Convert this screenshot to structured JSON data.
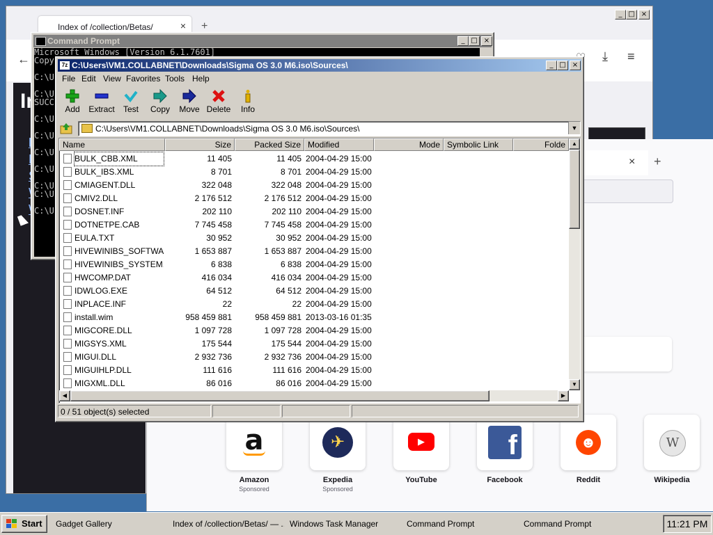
{
  "firefox_back": {
    "tab_title": "Index of /collection/Betas/",
    "tab_close": "×",
    "new_tab": "+",
    "page_heading": "In",
    "links": [
      "F",
      "P",
      "S",
      "W",
      "W"
    ]
  },
  "firefox_front": {
    "tab_close": "×",
    "new_tab": "+",
    "shortcuts": [
      {
        "label": "Amazon",
        "sponsored": "Sponsored",
        "glyph": "a"
      },
      {
        "label": "Expedia",
        "sponsored": "Sponsored",
        "glyph": "✈"
      },
      {
        "label": "YouTube",
        "sponsored": "",
        "glyph": "▶"
      },
      {
        "label": "Facebook",
        "sponsored": "",
        "glyph": "f"
      },
      {
        "label": "Reddit",
        "sponsored": "",
        "glyph": "☻"
      },
      {
        "label": "Wikipedia",
        "sponsored": "",
        "glyph": "W"
      }
    ]
  },
  "cmd": {
    "title": "Command Prompt",
    "console": "Microsoft Windows [Version 6.1.7601]\nCopy\n\nC:\\U\n\nC:\\U\nSUCC\n\nC:\\U\n\nC:\\U\n\nC:\\U\n\nC:\\U\n\nC:\\U\nC:\\U\n\nC:\\U"
  },
  "zip": {
    "title": "C:\\Users\\VM1.COLLABNET\\Downloads\\Sigma OS 3.0 M6.iso\\Sources\\",
    "menu": [
      "File",
      "Edit",
      "View",
      "Favorites",
      "Tools",
      "Help"
    ],
    "toolbar": [
      {
        "label": "Add",
        "icon": "plus-icon"
      },
      {
        "label": "Extract",
        "icon": "minus-icon"
      },
      {
        "label": "Test",
        "icon": "check-icon"
      },
      {
        "label": "Copy",
        "icon": "copy-arrow-icon"
      },
      {
        "label": "Move",
        "icon": "move-arrow-icon"
      },
      {
        "label": "Delete",
        "icon": "x-icon"
      },
      {
        "label": "Info",
        "icon": "info-icon"
      }
    ],
    "address": "C:\\Users\\VM1.COLLABNET\\Downloads\\Sigma OS 3.0 M6.iso\\Sources\\",
    "columns": [
      "Name",
      "Size",
      "Packed Size",
      "Modified",
      "Mode",
      "Symbolic Link",
      "Folde"
    ],
    "rows": [
      [
        "BULK_CBB.XML",
        "11 405",
        "11 405",
        "2004-04-29 15:00"
      ],
      [
        "BULK_IBS.XML",
        "8 701",
        "8 701",
        "2004-04-29 15:00"
      ],
      [
        "CMIAGENT.DLL",
        "322 048",
        "322 048",
        "2004-04-29 15:00"
      ],
      [
        "CMIV2.DLL",
        "2 176 512",
        "2 176 512",
        "2004-04-29 15:00"
      ],
      [
        "DOSNET.INF",
        "202 110",
        "202 110",
        "2004-04-29 15:00"
      ],
      [
        "DOTNETPE.CAB",
        "7 745 458",
        "7 745 458",
        "2004-04-29 15:00"
      ],
      [
        "EULA.TXT",
        "30 952",
        "30 952",
        "2004-04-29 15:00"
      ],
      [
        "HIVEWINIBS_SOFTWA...",
        "1 653 887",
        "1 653 887",
        "2004-04-29 15:00"
      ],
      [
        "HIVEWINIBS_SYSTEM....",
        "6 838",
        "6 838",
        "2004-04-29 15:00"
      ],
      [
        "HWCOMP.DAT",
        "416 034",
        "416 034",
        "2004-04-29 15:00"
      ],
      [
        "IDWLOG.EXE",
        "64 512",
        "64 512",
        "2004-04-29 15:00"
      ],
      [
        "INPLACE.INF",
        "22",
        "22",
        "2004-04-29 15:00"
      ],
      [
        "install.wim",
        "958 459 881",
        "958 459 881",
        "2013-03-16 01:35"
      ],
      [
        "MIGCORE.DLL",
        "1 097 728",
        "1 097 728",
        "2004-04-29 15:00"
      ],
      [
        "MIGSYS.XML",
        "175 544",
        "175 544",
        "2004-04-29 15:00"
      ],
      [
        "MIGUI.DLL",
        "2 932 736",
        "2 932 736",
        "2004-04-29 15:00"
      ],
      [
        "MIGUIHLP.DLL",
        "111 616",
        "111 616",
        "2004-04-29 15:00"
      ],
      [
        "MIGXML.DLL",
        "86 016",
        "86 016",
        "2004-04-29 15:00"
      ]
    ],
    "status": "0 / 51 object(s) selected"
  },
  "taskbar": {
    "start": "Start",
    "items": [
      "Gadget Gallery",
      "Index of /collection/Betas/ — ...",
      "Windows Task Manager",
      "Command Prompt",
      "Command Prompt"
    ],
    "clock": "11:21 PM"
  }
}
